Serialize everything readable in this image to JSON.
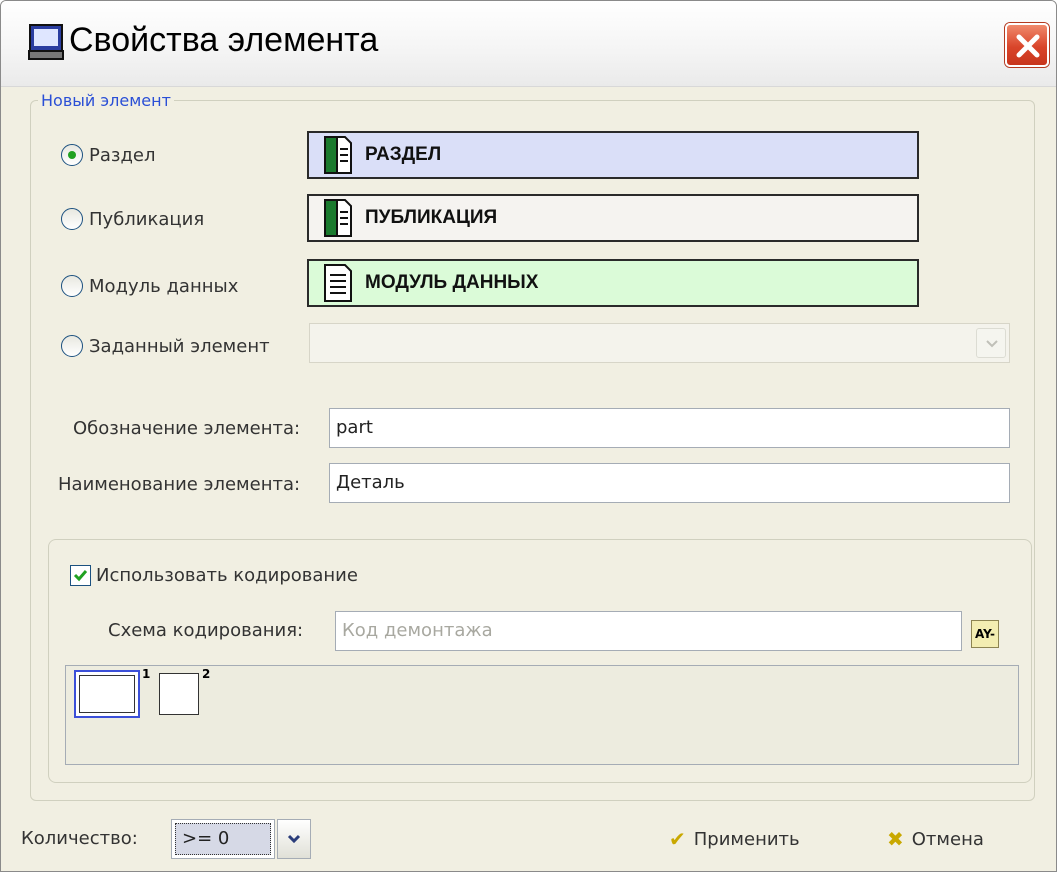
{
  "window": {
    "title": "Свойства элемента",
    "title_icon": "computer-icon",
    "close_icon": "close-icon"
  },
  "group": {
    "legend": "Новый элемент"
  },
  "element_types": [
    {
      "label": "Раздел",
      "box_text": "РАЗДЕЛ",
      "selected": true,
      "box_color": "#dadff8",
      "icon": "green-document-icon"
    },
    {
      "label": "Публикация",
      "box_text": "ПУБЛИКАЦИЯ",
      "selected": false,
      "box_color": "#f5f3f0",
      "icon": "green-document-icon"
    },
    {
      "label": "Модуль данных",
      "box_text": "МОДУЛЬ ДАННЫХ",
      "selected": false,
      "box_color": "#dbfbd8",
      "icon": "document-icon"
    },
    {
      "label": "Заданный элемент",
      "box_text": "",
      "selected": false,
      "box_color": "#f4f3ec",
      "icon": "chevron-down-icon"
    }
  ],
  "fields": {
    "designation_label": "Обозначение элемента:",
    "designation_value": "part",
    "name_label": "Наименование элемента:",
    "name_value": "Деталь"
  },
  "coding": {
    "use_label": "Использовать кодирование",
    "use_checked": true,
    "scheme_label": "Схема кодирования:",
    "scheme_value": "Код демонтажа",
    "scheme_button": "AY-",
    "cells": [
      "1",
      "2"
    ]
  },
  "footer": {
    "quantity_label": "Количество:",
    "quantity_value": ">= 0",
    "apply_label": "Применить",
    "cancel_label": "Отмена",
    "accent_green": "#21a121",
    "accent_yellow": "#d6b800"
  }
}
